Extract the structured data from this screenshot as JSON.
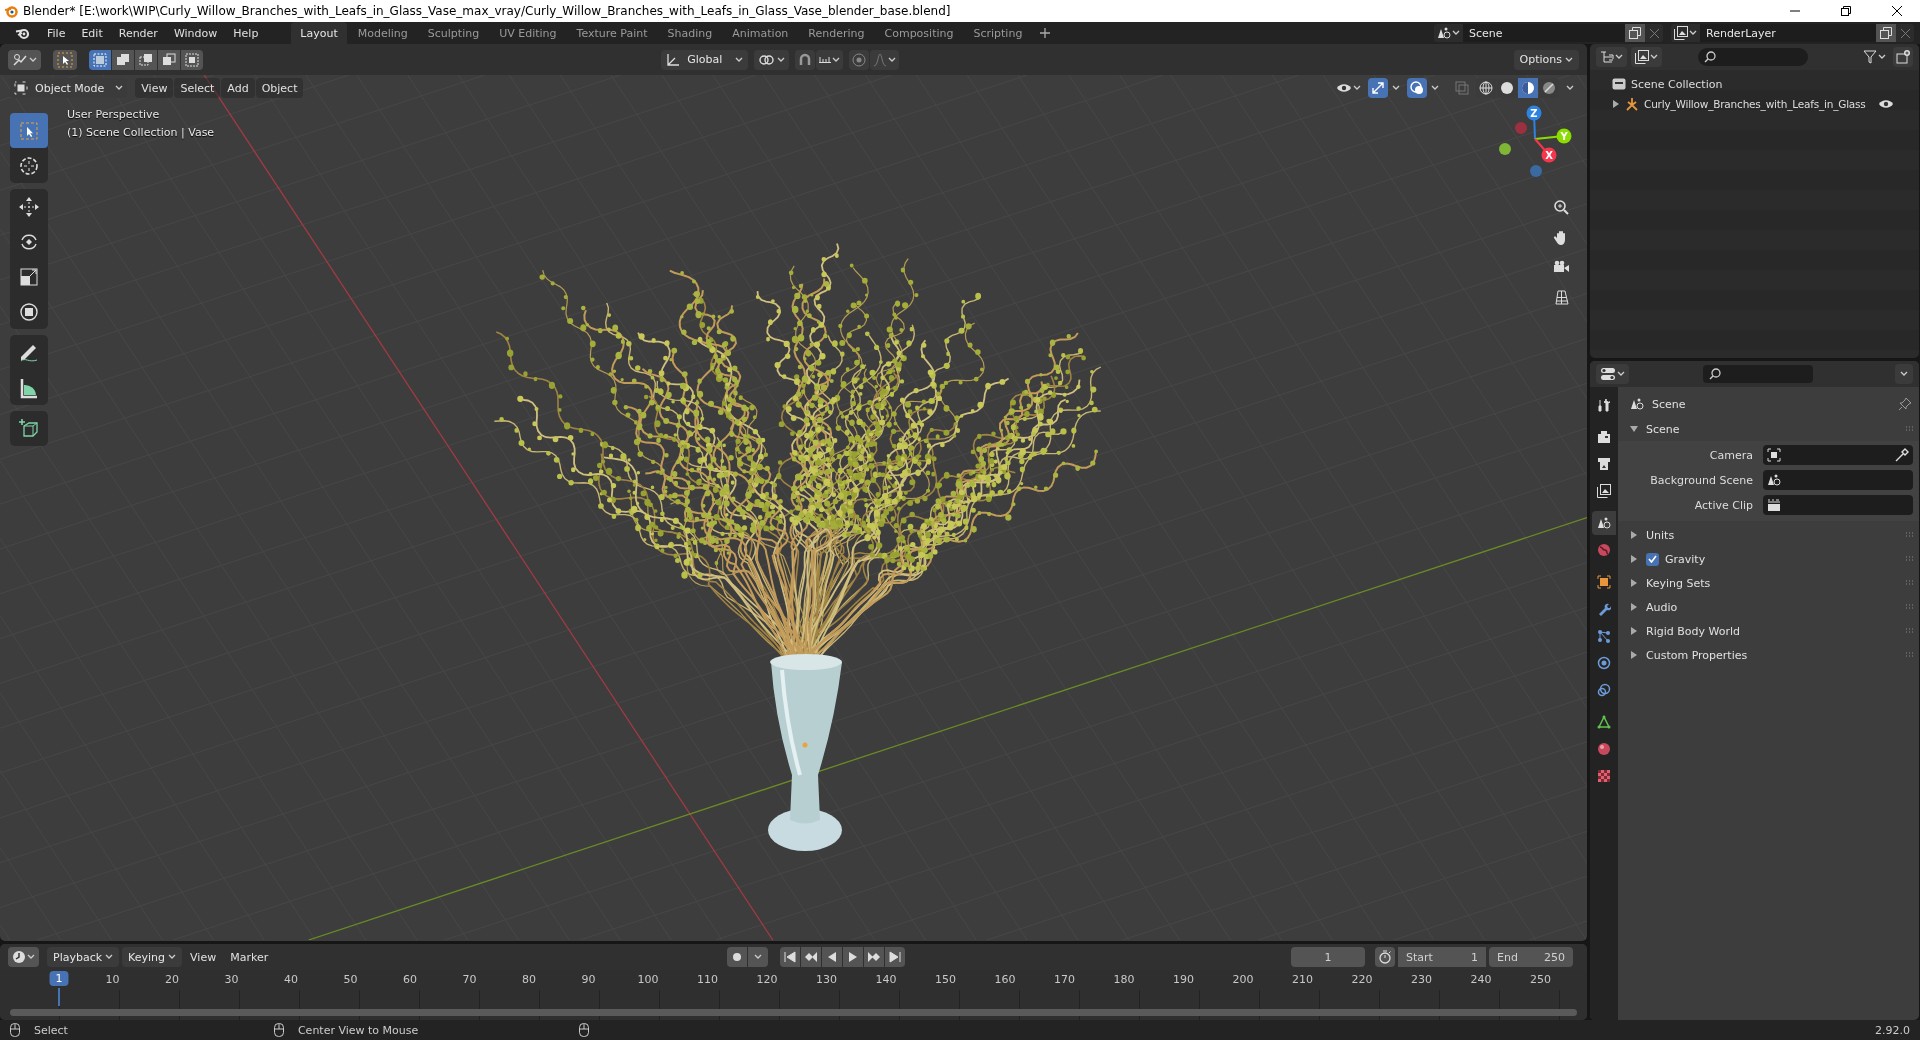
{
  "window": {
    "title": "Blender* [E:\\work\\WIP\\Curly_Willow_Branches_with_Leafs_in_Glass_Vase_max_vray/Curly_Willow_Branches_with_Leafs_in_Glass_Vase_blender_base.blend]"
  },
  "menu_bar": {
    "items": [
      "File",
      "Edit",
      "Render",
      "Window",
      "Help"
    ]
  },
  "workspace_tabs": [
    {
      "label": "Layout",
      "selected": true
    },
    {
      "label": "Modeling",
      "selected": false
    },
    {
      "label": "Sculpting",
      "selected": false
    },
    {
      "label": "UV Editing",
      "selected": false
    },
    {
      "label": "Texture Paint",
      "selected": false
    },
    {
      "label": "Shading",
      "selected": false
    },
    {
      "label": "Animation",
      "selected": false
    },
    {
      "label": "Rendering",
      "selected": false
    },
    {
      "label": "Compositing",
      "selected": false
    },
    {
      "label": "Scripting",
      "selected": false
    }
  ],
  "scene_selector": {
    "value": "Scene"
  },
  "view_layer_selector": {
    "value": "RenderLayer"
  },
  "tool_header": {
    "selection_modes": [
      {
        "selected": true
      },
      {
        "selected": false
      },
      {
        "selected": false
      },
      {
        "selected": false
      },
      {
        "selected": false
      }
    ],
    "orientation": "Global",
    "options_label": "Options"
  },
  "viewport": {
    "mode": "Object Mode",
    "menus": [
      "View",
      "Select",
      "Add",
      "Object"
    ],
    "overlay_lines": [
      "User Perspective",
      "(1) Scene Collection | Vase"
    ],
    "toolbar_groups": [
      [
        {
          "selected": true
        },
        {
          "selected": false
        }
      ],
      [
        {
          "selected": false
        },
        {
          "selected": false
        },
        {
          "selected": false
        },
        {
          "selected": false
        }
      ],
      [
        {
          "selected": false
        },
        {
          "selected": false
        }
      ],
      [
        {
          "selected": false
        }
      ]
    ],
    "gizmo_axes": [
      "Z",
      "Y",
      "X"
    ],
    "shading_modes": [
      {
        "selected": false
      },
      {
        "selected": false
      },
      {
        "selected": true
      },
      {
        "selected": false
      }
    ]
  },
  "outliner": {
    "root": "Scene Collection",
    "items": [
      {
        "label": "Curly_Willow_Branches_with_Leafs_in_Glass",
        "expanded": false,
        "visible": true
      }
    ]
  },
  "properties": {
    "tabs": [
      {
        "selected": false
      },
      {
        "selected": false
      },
      {
        "selected": false
      },
      {
        "selected": false
      },
      {
        "selected": true
      },
      {
        "selected": false
      },
      {
        "selected": false
      },
      {
        "selected": false
      },
      {
        "selected": false
      },
      {
        "selected": false
      },
      {
        "selected": false
      },
      {
        "selected": false
      },
      {
        "selected": false
      },
      {
        "selected": false
      }
    ],
    "context": "Scene",
    "panels": [
      {
        "label": "Scene",
        "kind": "fields",
        "expanded": true,
        "fields": [
          {
            "label": "Camera",
            "kind": "camera"
          },
          {
            "label": "Background Scene",
            "kind": "scene"
          },
          {
            "label": "Active Clip",
            "kind": "clip"
          }
        ]
      },
      {
        "label": "Units",
        "kind": "plain",
        "expanded": false
      },
      {
        "label": "Gravity",
        "kind": "checkbox",
        "expanded": false,
        "checked": true
      },
      {
        "label": "Keying Sets",
        "kind": "plain",
        "expanded": false
      },
      {
        "label": "Audio",
        "kind": "plain",
        "expanded": false
      },
      {
        "label": "Rigid Body World",
        "kind": "plain",
        "expanded": false
      },
      {
        "label": "Custom Properties",
        "kind": "plain",
        "expanded": false
      }
    ]
  },
  "timeline": {
    "menus": [
      "Playback",
      "Keying",
      "View",
      "Marker"
    ],
    "current_frame": "1",
    "start_label": "Start",
    "start": "1",
    "end_label": "End",
    "end": "250",
    "ruler_labels": [
      "1",
      "10",
      "20",
      "30",
      "40",
      "50",
      "60",
      "70",
      "80",
      "90",
      "100",
      "110",
      "120",
      "130",
      "140",
      "150",
      "160",
      "170",
      "180",
      "190",
      "200",
      "210",
      "220",
      "230",
      "240",
      "250"
    ]
  },
  "status_bar": {
    "hints": [
      "Select",
      "Center View to Mouse"
    ],
    "version": "2.92.0"
  }
}
